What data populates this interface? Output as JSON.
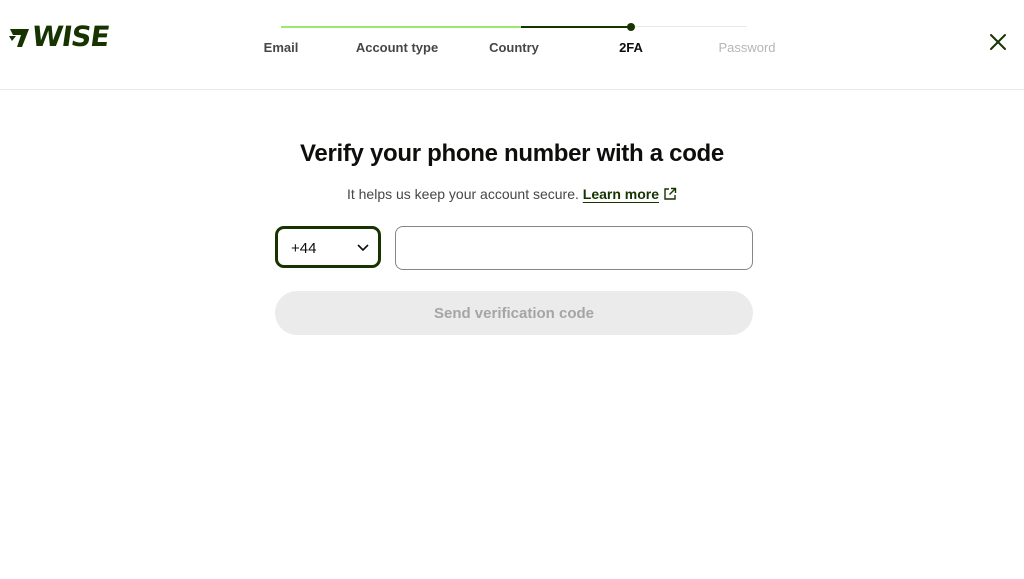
{
  "brand": {
    "name": "WISE",
    "color": "#163300",
    "accent": "#9fe870"
  },
  "stepper": {
    "steps": [
      {
        "label": "Email",
        "state": "done"
      },
      {
        "label": "Account type",
        "state": "done"
      },
      {
        "label": "Country",
        "state": "done"
      },
      {
        "label": "2FA",
        "state": "current"
      },
      {
        "label": "Password",
        "state": "pending"
      }
    ]
  },
  "header": {
    "close_icon": "close-icon"
  },
  "main": {
    "title": "Verify your phone number with a code",
    "subtitle": "It helps us keep your account secure.",
    "learn_more": "Learn more",
    "learn_more_icon": "external-link-icon",
    "country_code": {
      "value": "+44",
      "icon": "chevron-down-icon"
    },
    "phone_number": {
      "value": "",
      "placeholder": ""
    },
    "send_button": "Send verification code"
  }
}
